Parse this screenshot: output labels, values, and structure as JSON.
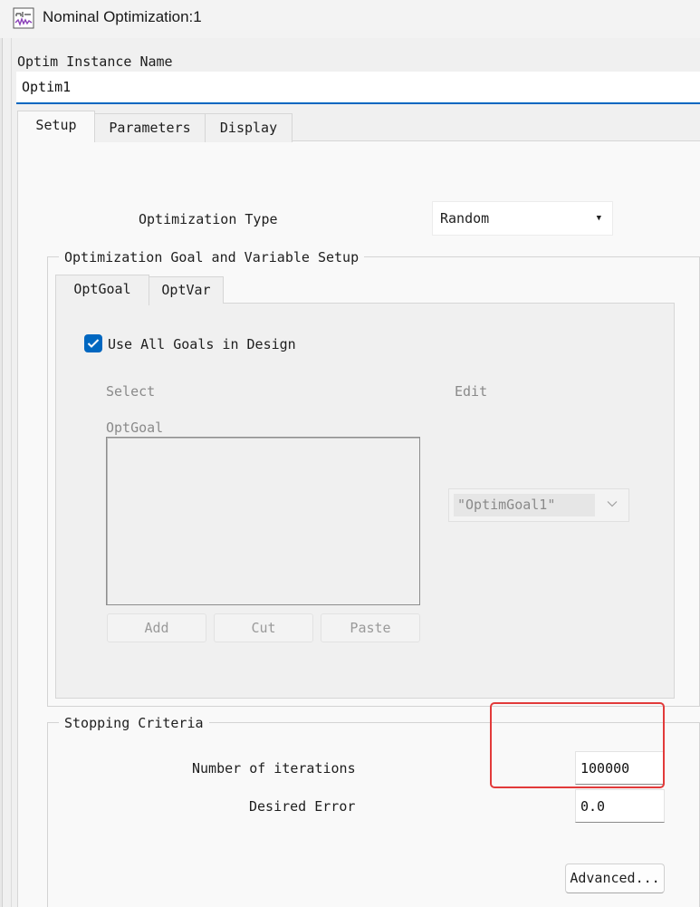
{
  "window": {
    "title": "Nominal Optimization:1",
    "icon": "waveform-icon"
  },
  "instance": {
    "label": "Optim Instance Name",
    "value": "Optim1"
  },
  "tabs": [
    {
      "label": "Setup",
      "active": true
    },
    {
      "label": "Parameters",
      "active": false
    },
    {
      "label": "Display",
      "active": false
    }
  ],
  "setup": {
    "optimization_type_label": "Optimization Type",
    "optimization_type_value": "Random",
    "goal_group": {
      "title": "Optimization Goal and Variable Setup",
      "tabs": [
        {
          "label": "OptGoal",
          "active": true
        },
        {
          "label": "OptVar",
          "active": false
        }
      ],
      "use_all_goals_label": "Use All Goals in Design",
      "use_all_goals_checked": true,
      "select_label": "Select",
      "edit_label": "Edit",
      "list_label": "OptGoal",
      "edit_value": "\"OptimGoal1\"",
      "buttons": {
        "add": "Add",
        "cut": "Cut",
        "paste": "Paste"
      }
    },
    "stopping": {
      "title": "Stopping Criteria",
      "iterations_label": "Number of iterations",
      "iterations_value": "100000",
      "error_label": "Desired Error",
      "error_value": "0.0",
      "advanced_label": "Advanced..."
    }
  },
  "colors": {
    "accent": "#0067c0",
    "highlight": "#e23a3a"
  }
}
